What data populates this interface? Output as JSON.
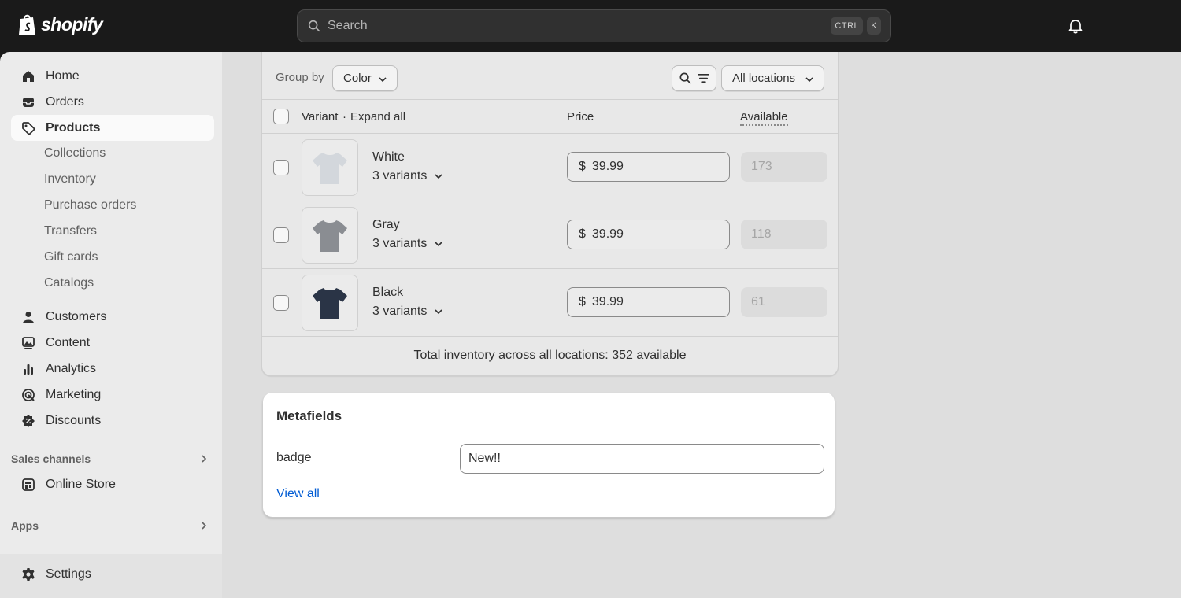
{
  "app": {
    "brand": "shopify"
  },
  "search": {
    "placeholder": "Search",
    "shortcut_ctrl": "CTRL",
    "shortcut_key": "K"
  },
  "sidebar": {
    "primary": [
      {
        "label": "Home",
        "icon": "home-icon"
      },
      {
        "label": "Orders",
        "icon": "inbox-icon"
      },
      {
        "label": "Products",
        "icon": "tag-icon",
        "active": true
      }
    ],
    "products_sub": [
      "Collections",
      "Inventory",
      "Purchase orders",
      "Transfers",
      "Gift cards",
      "Catalogs"
    ],
    "secondary": [
      {
        "label": "Customers",
        "icon": "person-icon"
      },
      {
        "label": "Content",
        "icon": "image-icon"
      },
      {
        "label": "Analytics",
        "icon": "bar-chart-icon"
      },
      {
        "label": "Marketing",
        "icon": "target-icon"
      },
      {
        "label": "Discounts",
        "icon": "discount-icon"
      }
    ],
    "sales_channels_label": "Sales channels",
    "online_store": "Online Store",
    "apps_label": "Apps",
    "settings": "Settings"
  },
  "variants_card": {
    "group_by_label": "Group by",
    "group_by_value": "Color",
    "locations_label": "All locations",
    "columns": {
      "variant": "Variant",
      "expand_all": "Expand all",
      "price": "Price",
      "available": "Available"
    },
    "rows": [
      {
        "name": "White",
        "variants": "3 variants",
        "currency": "$",
        "price": "39.99",
        "available": "173",
        "shirt_color": "#d3d7dc"
      },
      {
        "name": "Gray",
        "variants": "3 variants",
        "currency": "$",
        "price": "39.99",
        "available": "118",
        "shirt_color": "#8a8d92"
      },
      {
        "name": "Black",
        "variants": "3 variants",
        "currency": "$",
        "price": "39.99",
        "available": "61",
        "shirt_color": "#2a3446"
      }
    ],
    "total": "Total inventory across all locations: 352 available"
  },
  "metafields": {
    "title": "Metafields",
    "field_label": "badge",
    "field_value": "New!!",
    "view_all": "View all"
  },
  "colors": {
    "link": "#005bd3",
    "topbar": "#1a1a1a"
  }
}
